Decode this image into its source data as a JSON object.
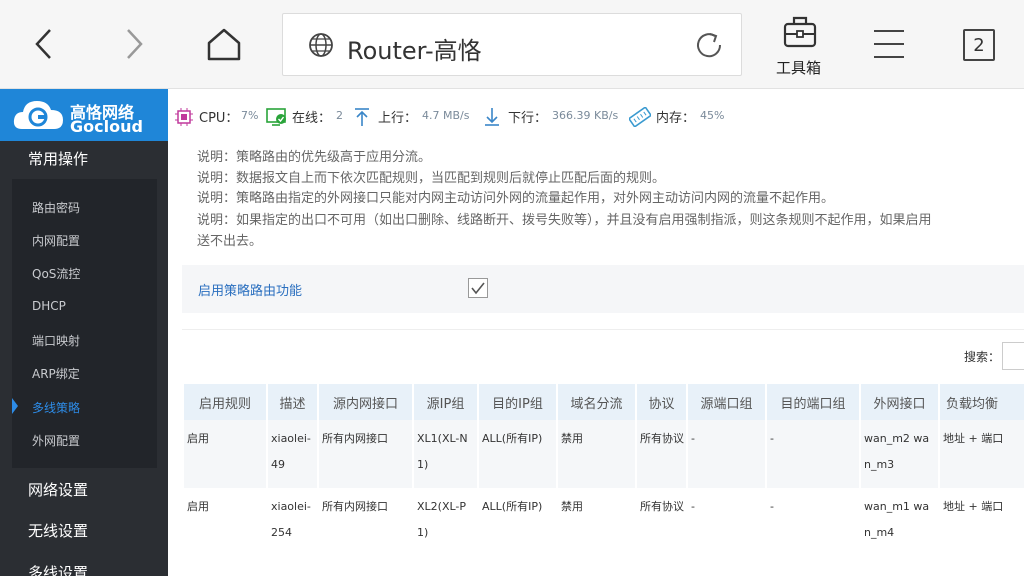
{
  "browser": {
    "url_title": "Router-高恪",
    "toolbox_label": "工具箱",
    "tab_count": "2"
  },
  "brand": {
    "name_cn": "高恪网络",
    "name_en": "Gocloud",
    "color": "#1f86d8"
  },
  "sidebar": {
    "section_common": "常用操作",
    "items": [
      {
        "label": "路由密码"
      },
      {
        "label": "内网配置"
      },
      {
        "label": "QoS流控"
      },
      {
        "label": "DHCP"
      },
      {
        "label": "端口映射"
      },
      {
        "label": "ARP绑定"
      },
      {
        "label": "多线策略",
        "active": true
      },
      {
        "label": "外网配置"
      }
    ],
    "section_network": "网络设置",
    "section_wireless": "无线设置",
    "section_multiline": "多线设置"
  },
  "status": {
    "cpu_label": "CPU：",
    "cpu_value": "7%",
    "online_label": "在线：",
    "online_value": "2",
    "up_label": "上行：",
    "up_value": "4.7 MB/s",
    "down_label": "下行：",
    "down_value": "366.39 KB/s",
    "mem_label": "内存：",
    "mem_value": "45%"
  },
  "notes": [
    "说明：策略路由的优先级高于应用分流。",
    "说明：数据报文自上而下依次匹配规则，当匹配到规则后就停止匹配后面的规则。",
    "说明：策略路由指定的外网接口只能对内网主动访问外网的流量起作用，对外网主动访问内网的流量不起作用。",
    "说明：如果指定的出口不可用（如出口删除、线路断开、拨号失败等），并且没有启用强制指派，则这条规则不起作用，如果启用",
    "送不出去。"
  ],
  "policy_toggle": {
    "label": "启用策略路由功能",
    "checked": true
  },
  "search": {
    "label": "搜索："
  },
  "table": {
    "headers": [
      "启用规则",
      "描述",
      "源内网接口",
      "源IP组",
      "目的IP组",
      "域名分流",
      "协议",
      "源端口组",
      "目的端口组",
      "外网接口",
      "负载均衡"
    ],
    "rows": [
      [
        "启用",
        "xiaolei-49",
        "所有内网接口",
        "XL1(XL-N1)",
        "ALL(所有IP)",
        "禁用",
        "所有协议",
        "-",
        "-",
        "wan_m2 wan_m3",
        "地址 + 端口"
      ],
      [
        "启用",
        "xiaolei-254",
        "所有内网接口",
        "XL2(XL-P1)",
        "ALL(所有IP)",
        "禁用",
        "所有协议",
        "-",
        "-",
        "wan_m1 wan_m4",
        "地址 + 端口"
      ]
    ]
  }
}
